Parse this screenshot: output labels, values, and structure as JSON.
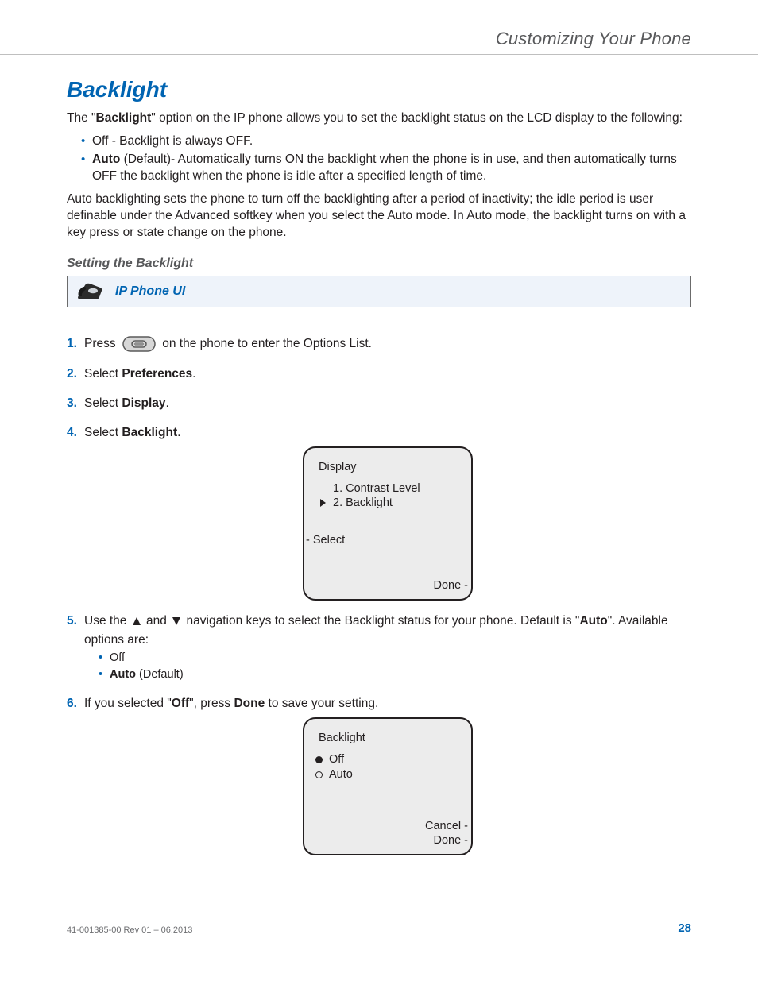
{
  "header": {
    "running_head": "Customizing Your Phone"
  },
  "section": {
    "title": "Backlight",
    "intro_prefix": "The \"",
    "intro_bold": "Backlight",
    "intro_suffix": "\" option on the IP phone allows you to set the backlight status on the LCD display to the following:",
    "bullets": {
      "off": "Off - Backlight is always OFF.",
      "auto_bold": "Auto",
      "auto_rest": " (Default)- Automatically turns ON the backlight when the phone is in use, and then automatically turns OFF the backlight when the phone is idle after a specified length of time."
    },
    "para2": "Auto backlighting sets the phone to turn off the backlighting after a period of inactivity; the idle period is user definable under the Advanced softkey when you select the Auto mode. In Auto mode, the backlight turns on with a key press or state change on the phone."
  },
  "sub": {
    "heading": "Setting the Backlight",
    "banner_label": "IP Phone UI"
  },
  "steps": {
    "s1a": "Press",
    "s1b": "on the phone to enter the Options List.",
    "s2a": "Select ",
    "s2b": "Preferences",
    "s2c": ".",
    "s3a": "Select ",
    "s3b": "Display",
    "s3c": ".",
    "s4a": "Select ",
    "s4b": "Backlight",
    "s4c": ".",
    "s5a": "Use the",
    "s5b": "and",
    "s5c": "navigation keys to select the Backlight status for your phone. Default is \"",
    "s5bold": "Auto",
    "s5d": "\". Available options are:",
    "s5_opts": {
      "off": "Off",
      "auto_bold": "Auto",
      "auto_rest": " (Default)"
    },
    "s6a": "If you selected \"",
    "s6b": "Off",
    "s6c": "\", press ",
    "s6d": "Done",
    "s6e": " to save your setting."
  },
  "lcd1": {
    "title": "Display",
    "item1": "1. Contrast Level",
    "item2": "2. Backlight",
    "left": "- Select",
    "right": "Done -"
  },
  "lcd2": {
    "title": "Backlight",
    "opt1": "Off",
    "opt2": "Auto",
    "right1": "Cancel -",
    "right2": "Done -"
  },
  "footer": {
    "doc_ref": "41-001385-00 Rev 01 – 06.2013",
    "page": "28"
  }
}
